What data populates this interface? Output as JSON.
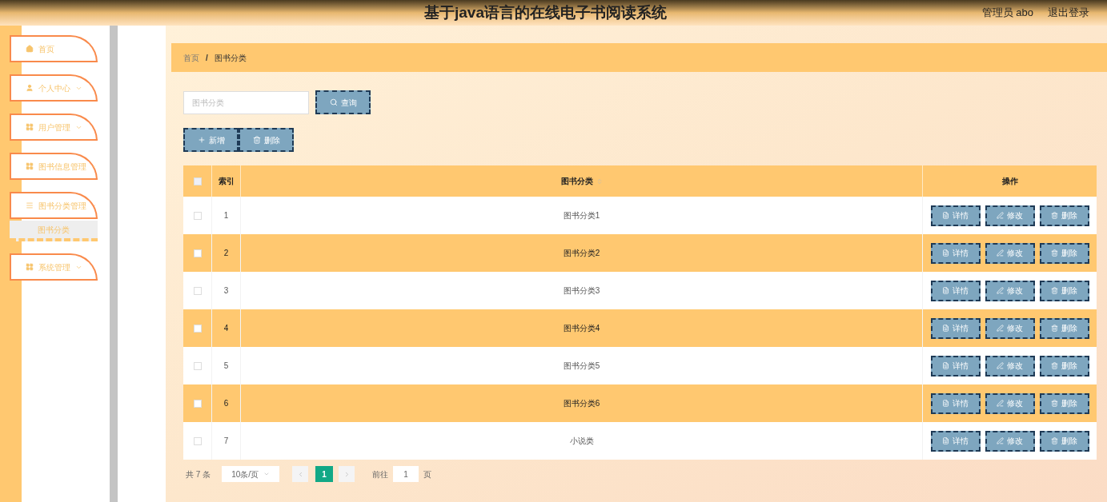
{
  "header": {
    "title": "基于java语言的在线电子书阅读系统",
    "user": "管理员 abo",
    "logout": "退出登录"
  },
  "sidebar": {
    "items": [
      {
        "label": "首页",
        "kind": "home"
      },
      {
        "label": "个人中心",
        "kind": "user",
        "expanded": false
      },
      {
        "label": "用户管理",
        "kind": "grid",
        "expanded": false
      },
      {
        "label": "图书信息管理",
        "kind": "grid",
        "expanded": false
      },
      {
        "label": "图书分类管理",
        "kind": "list",
        "expanded": true,
        "children": [
          {
            "label": "图书分类",
            "selected": true
          }
        ]
      },
      {
        "label": "系统管理",
        "kind": "grid",
        "expanded": false
      }
    ]
  },
  "breadcrumb": {
    "items": [
      "首页",
      "图书分类"
    ],
    "separator": "/"
  },
  "search": {
    "placeholder": "图书分类",
    "button": "查询"
  },
  "actions": [
    "新增",
    "删除"
  ],
  "table": {
    "header_checked": false,
    "columns": [
      "索引",
      "图书分类",
      "操作"
    ],
    "rows": [
      {
        "index": "1",
        "category": "图书分类1",
        "checked": false,
        "buttons": [
          "详情",
          "修改",
          "删除"
        ]
      },
      {
        "index": "2",
        "category": "图书分类2",
        "checked": false,
        "buttons": [
          "详情",
          "修改",
          "删除"
        ]
      },
      {
        "index": "3",
        "category": "图书分类3",
        "checked": false,
        "buttons": [
          "详情",
          "修改",
          "删除"
        ]
      },
      {
        "index": "4",
        "category": "图书分类4",
        "checked": false,
        "buttons": [
          "详情",
          "修改",
          "删除"
        ]
      },
      {
        "index": "5",
        "category": "图书分类5",
        "checked": false,
        "buttons": [
          "详情",
          "修改",
          "删除"
        ]
      },
      {
        "index": "6",
        "category": "图书分类6",
        "checked": false,
        "buttons": [
          "详情",
          "修改",
          "删除"
        ]
      },
      {
        "index": "7",
        "category": "小说类",
        "checked": false,
        "buttons": [
          "详情",
          "修改",
          "删除"
        ]
      }
    ]
  },
  "pagination": {
    "total": "共 7 条",
    "page_size": "10条/页",
    "pages": [
      {
        "label": "1",
        "selected": true
      }
    ],
    "goto_label": "前往",
    "goto_value": "1",
    "goto_suffix": "页"
  }
}
